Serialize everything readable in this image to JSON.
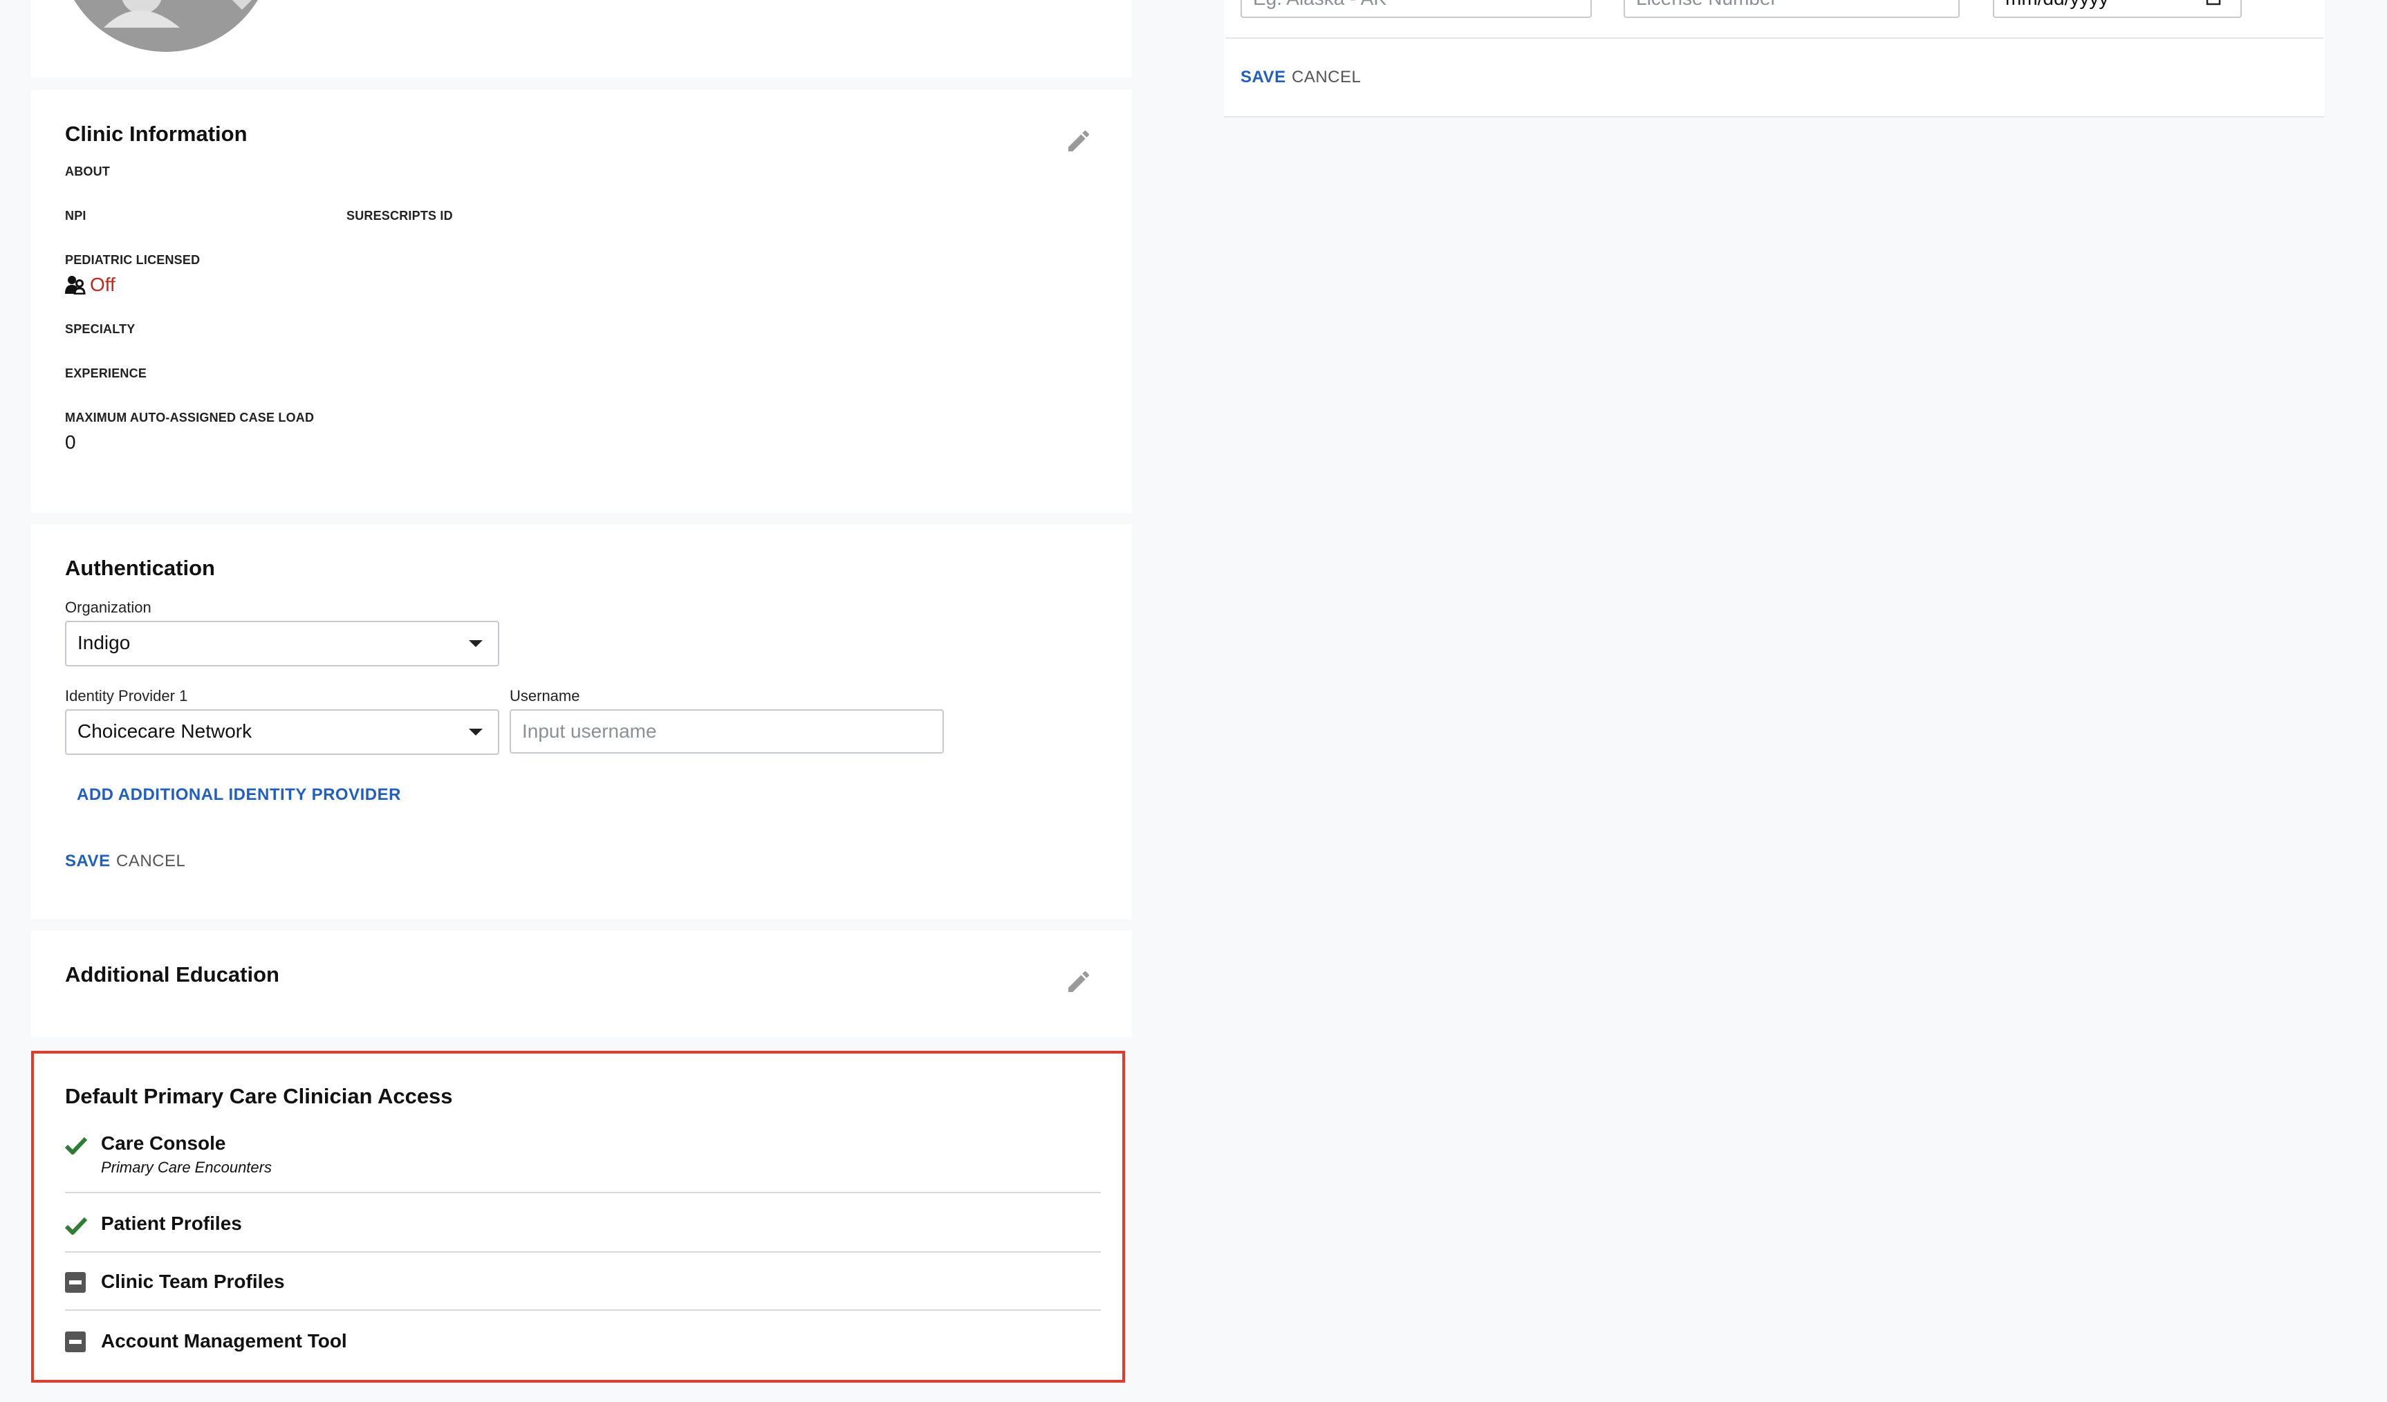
{
  "right_panel": {
    "state_placeholder": "Eg. Alaska - AK",
    "license_placeholder": "License Number",
    "date_placeholder": "mm/dd/yyyy",
    "save": "SAVE",
    "cancel": "CANCEL"
  },
  "clinic_info": {
    "title": "Clinic Information",
    "about": "ABOUT",
    "npi": "NPI",
    "surescripts": "SURESCRIPTS ID",
    "pediatric_label": "PEDIATRIC LICENSED",
    "pediatric_value": "Off",
    "specialty": "SPECIALTY",
    "experience": "EXPERIENCE",
    "caseload_label": "MAXIMUM AUTO-ASSIGNED CASE LOAD",
    "caseload_value": "0"
  },
  "authentication": {
    "title": "Authentication",
    "org_label": "Organization",
    "org_value": "Indigo",
    "idp_label": "Identity Provider 1",
    "idp_value": "Choicecare Network",
    "username_label": "Username",
    "username_placeholder": "Input username",
    "add_idp": "ADD ADDITIONAL IDENTITY PROVIDER",
    "save": "SAVE",
    "cancel": "CANCEL"
  },
  "additional_education": {
    "title": "Additional Education"
  },
  "access": {
    "title": "Default Primary Care Clinician Access",
    "items": [
      {
        "label": "Care Console",
        "sub": "Primary Care Encounters",
        "status": "check"
      },
      {
        "label": "Patient Profiles",
        "sub": "",
        "status": "check"
      },
      {
        "label": "Clinic Team Profiles",
        "sub": "",
        "status": "partial"
      },
      {
        "label": "Account Management Tool",
        "sub": "",
        "status": "partial"
      }
    ]
  },
  "colors": {
    "accent_blue": "#1f5fc4",
    "off_red": "#c0281c",
    "check_green": "#2e7d32",
    "highlight_red": "#e23b2a"
  }
}
